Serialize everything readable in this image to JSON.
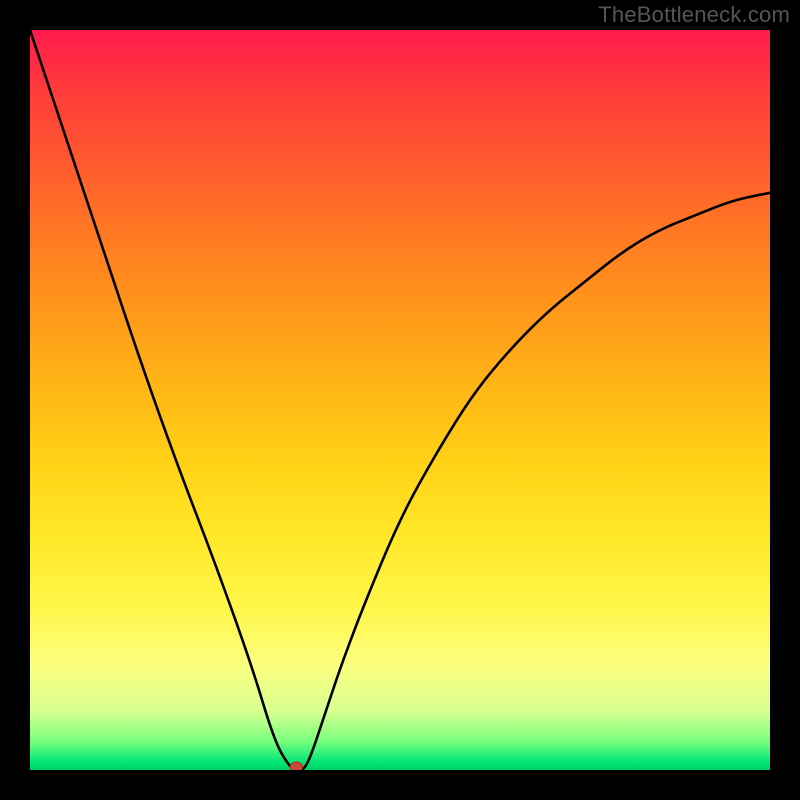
{
  "watermark": "TheBottleneck.com",
  "colors": {
    "background": "#000000",
    "gradient_top": "#ff1a4d",
    "gradient_bottom": "#00d060",
    "curve": "#000000",
    "marker": "#cc4a3a"
  },
  "chart_data": {
    "type": "line",
    "title": "",
    "xlabel": "",
    "ylabel": "",
    "xlim": [
      0,
      100
    ],
    "ylim": [
      0,
      100
    ],
    "x": [
      0,
      5,
      10,
      15,
      20,
      25,
      30,
      33,
      35,
      36,
      37,
      38,
      40,
      42,
      45,
      50,
      55,
      60,
      65,
      70,
      75,
      80,
      85,
      90,
      95,
      100
    ],
    "values": [
      100,
      85,
      70,
      55,
      41,
      28,
      14,
      4,
      0.5,
      0,
      0,
      2,
      8,
      14,
      22,
      34,
      43,
      51,
      57,
      62,
      66,
      70,
      73,
      75,
      77,
      78
    ],
    "minimum_x": 36,
    "minimum_y": 0,
    "background_meaning": "bottleneck severity gradient (top=high, bottom=low)"
  }
}
